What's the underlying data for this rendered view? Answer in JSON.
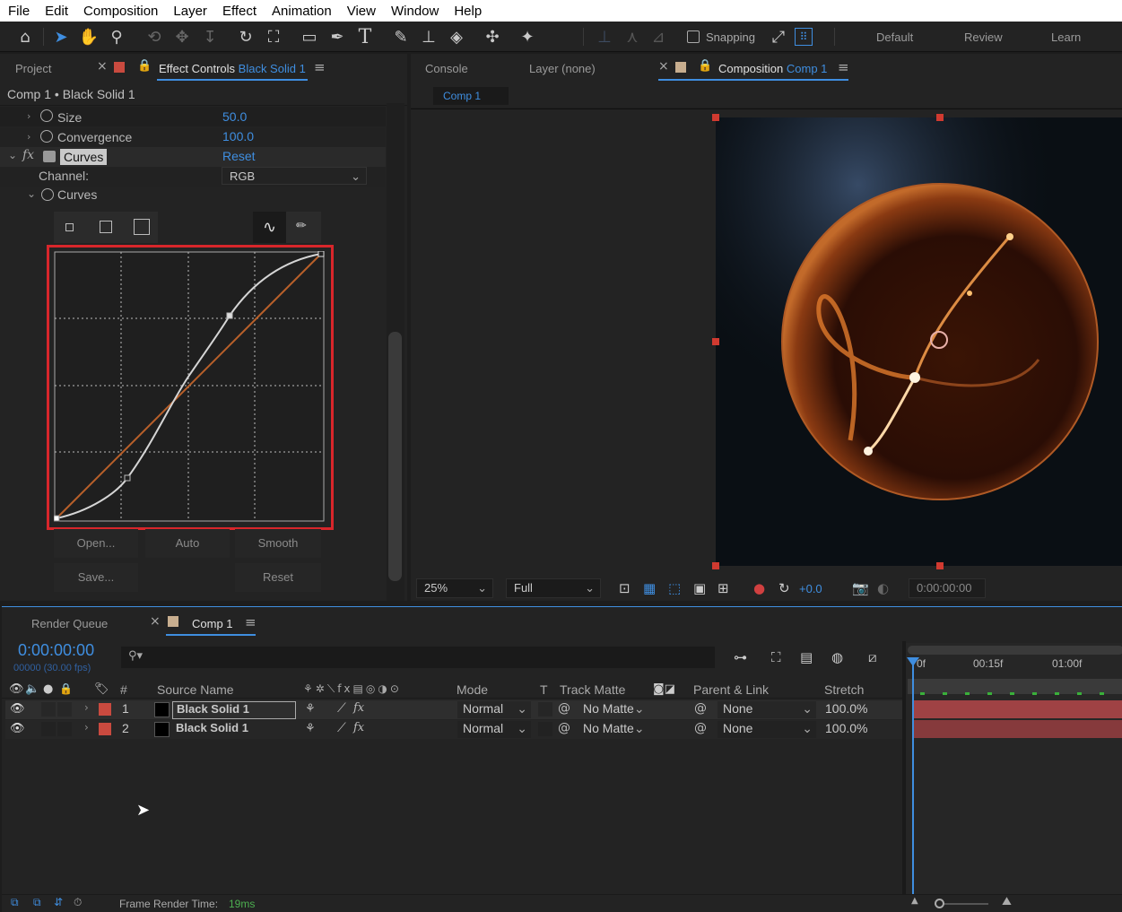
{
  "menu": [
    "File",
    "Edit",
    "Composition",
    "Layer",
    "Effect",
    "Animation",
    "View",
    "Window",
    "Help"
  ],
  "toolbar": {
    "snapping_label": "Snapping",
    "workspaces": [
      "Default",
      "Review",
      "Learn"
    ]
  },
  "left_panel": {
    "tab_project": "Project",
    "tab_effect_controls": "Effect Controls",
    "tab_effect_layer": "Black Solid 1",
    "breadcrumb": "Comp 1 • Black Solid 1",
    "props": [
      {
        "name": "Size",
        "value": "50.0"
      },
      {
        "name": "Convergence",
        "value": "100.0"
      }
    ],
    "curves_effect": "Curves",
    "reset_label": "Reset",
    "channel_label": "Channel:",
    "channel_value": "RGB",
    "curves_prop": "Curves",
    "buttons": {
      "open": "Open...",
      "auto": "Auto",
      "smooth": "Smooth",
      "save": "Save...",
      "reset": "Reset"
    }
  },
  "right_panel": {
    "tab_console": "Console",
    "tab_layer": "Layer (none)",
    "tab_composition": "Composition",
    "tab_comp_name": "Comp 1",
    "sub_tab": "Comp 1",
    "zoom": "25%",
    "resolution": "Full",
    "exposure": "+0.0",
    "timecode": "0:00:00:00"
  },
  "timeline": {
    "tab_render_queue": "Render Queue",
    "tab_comp": "Comp 1",
    "current_time": "0:00:00:00",
    "frame_info": "00000 (30.00 fps)",
    "search_placeholder": "",
    "headers": {
      "num": "#",
      "source_name": "Source Name",
      "mode": "Mode",
      "t": "T",
      "track_matte": "Track Matte",
      "parent_link": "Parent & Link",
      "stretch": "Stretch"
    },
    "ruler": [
      "0f",
      "00:15f",
      "01:00f"
    ],
    "layers": [
      {
        "num": "1",
        "name": "Black Solid 1",
        "mode": "Normal",
        "matte": "No Matte",
        "parent": "None",
        "stretch": "100.0%"
      },
      {
        "num": "2",
        "name": "Black Solid 1",
        "mode": "Normal",
        "matte": "No Matte",
        "parent": "None",
        "stretch": "100.0%"
      }
    ],
    "frame_render_label": "Frame Render Time:",
    "frame_render_value": "19ms"
  },
  "colors": {
    "accent_blue": "#3f8ee0",
    "highlight_red": "#d8262b",
    "layer_red": "#c94a3f",
    "bar_red": "#9f4244"
  }
}
